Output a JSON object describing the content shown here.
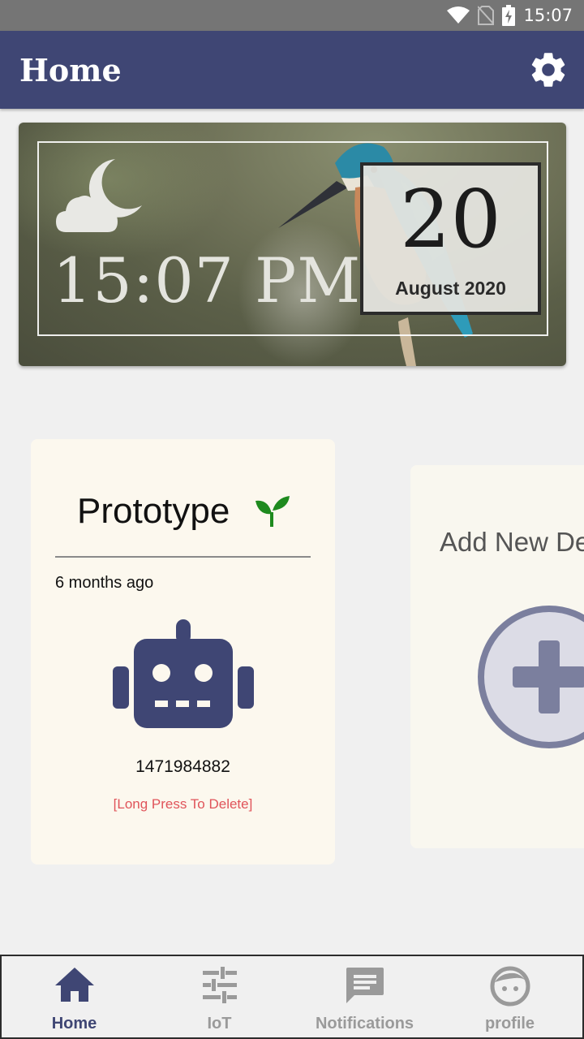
{
  "status_bar": {
    "time": "15:07"
  },
  "app_bar": {
    "title": "Home",
    "settings_icon": "gear-icon"
  },
  "hero": {
    "weather_icon": "cloud-moon-icon",
    "time": "15:07 PM",
    "day": "20",
    "month_year": "August 2020"
  },
  "devices": [
    {
      "name": "Prototype",
      "status_icon": "sprout-icon",
      "last_seen": "6 months ago",
      "icon": "robot-icon",
      "id": "1471984882",
      "hint": "[Long Press To Delete]"
    }
  ],
  "add_device": {
    "label": "Add New De",
    "icon": "add-circle-icon"
  },
  "nav": {
    "items": [
      {
        "label": "Home",
        "icon": "home-icon",
        "active": true
      },
      {
        "label": "IoT",
        "icon": "sliders-icon",
        "active": false
      },
      {
        "label": "Notifications",
        "icon": "message-icon",
        "active": false
      },
      {
        "label": "profile",
        "icon": "face-icon",
        "active": false
      }
    ]
  },
  "colors": {
    "primary": "#3f4674",
    "card": "#fcf8ee",
    "hint": "#e0545a",
    "sprout": "#1e8a1e",
    "inactive": "#9a9a9a"
  }
}
